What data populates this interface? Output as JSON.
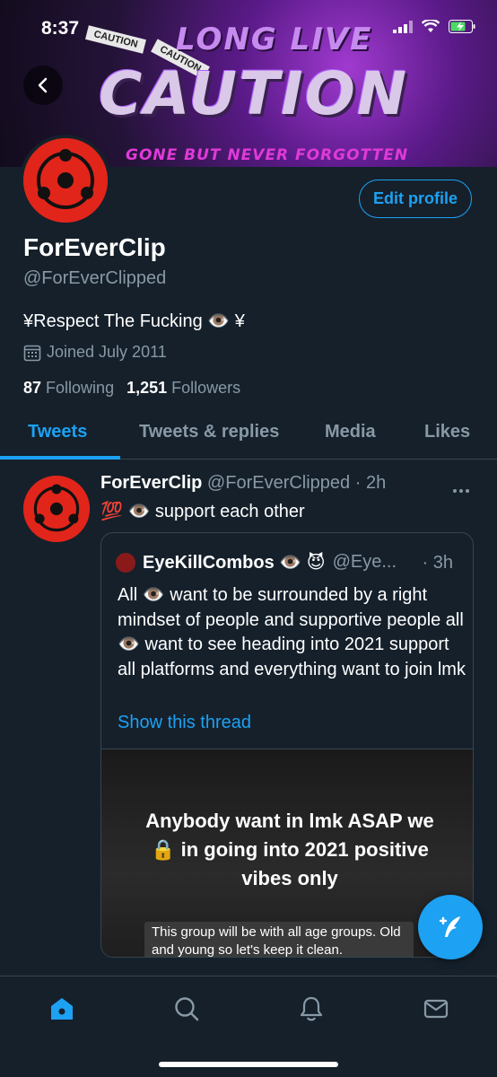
{
  "status_bar": {
    "time": "8:37"
  },
  "banner": {
    "main_text": "CAUTION",
    "top_text": "LONG LIVE",
    "bottom_text": "GONE BUT NEVER FORGOTTEN",
    "tape_text": "CAUTION"
  },
  "profile": {
    "edit_label": "Edit profile",
    "display_name": "ForEverClip",
    "handle": "@ForEverClipped",
    "bio": "¥Respect The Fucking 👁️ ¥",
    "joined": "Joined July 2011",
    "following_count": "87",
    "following_label": "Following",
    "followers_count": "1,251",
    "followers_label": "Followers"
  },
  "tabs": [
    {
      "label": "Tweets",
      "active": true
    },
    {
      "label": "Tweets & replies",
      "active": false
    },
    {
      "label": "Media",
      "active": false
    },
    {
      "label": "Likes",
      "active": false
    }
  ],
  "tweet": {
    "author": "ForEverClip",
    "meta": "@ForEverClipped · 2h",
    "text": "💯 👁️ support each other",
    "quote": {
      "author": "EyeKillCombos 👁️ 😈",
      "handle": "@Eye...",
      "time": "· 3h",
      "text": "All 👁️ want to be surrounded by a right mindset of people and supportive people all 👁️ want to see heading into 2021 support all platforms and everything want to join lmk",
      "show_thread": "Show this thread",
      "media_title": "Anybody want in lmk ASAP we 🔒 in going into 2021 positive vibes only",
      "media_caption": "This group will be with all age groups. Old and young so let's keep it clean."
    }
  },
  "colors": {
    "accent": "#1da1f2",
    "background": "#15202b",
    "muted": "#8899a6",
    "border": "#38444d",
    "avatar_red": "#e1251b"
  },
  "icons": [
    "back-arrow-icon",
    "calendar-icon",
    "more-icon",
    "compose-icon",
    "home-icon",
    "search-icon",
    "bell-icon",
    "mail-icon"
  ]
}
